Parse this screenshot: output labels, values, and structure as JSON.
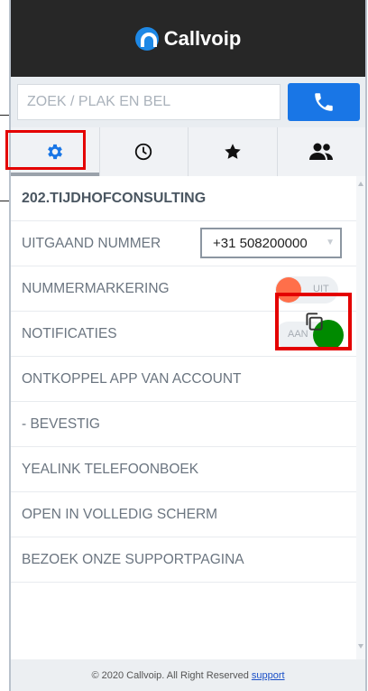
{
  "app": {
    "name": "Callvoip"
  },
  "search": {
    "placeholder": "ZOEK / PLAK EN BEL",
    "value": ""
  },
  "tabs": [
    {
      "name": "settings",
      "icon": "gear-icon"
    },
    {
      "name": "history",
      "icon": "clock-icon"
    },
    {
      "name": "favorites",
      "icon": "star-icon"
    },
    {
      "name": "contacts",
      "icon": "people-icon"
    }
  ],
  "settings": {
    "account": "202.TIJDHOFCONSULTING",
    "outgoing_label": "UITGAAND NUMMER",
    "outgoing_value": "+31 508200000",
    "marking_label": "NUMMERMARKERING",
    "marking_state": "UIT",
    "notifications_label": "NOTIFICATIES",
    "notifications_state": "AAN",
    "disconnect_label": "ONTKOPPEL APP VAN ACCOUNT",
    "confirm_label": "- BEVESTIG",
    "yealink_label": "YEALINK TELEFOONBOEK",
    "fullscreen_label": "OPEN IN VOLLEDIG SCHERM",
    "support_page_label": "BEZOEK ONZE SUPPORTPAGINA"
  },
  "footer": {
    "text": "© 2020 Callvoip. All Right Reserved",
    "link": "support"
  },
  "colors": {
    "accent": "#1976e6",
    "toggle_off": "#ff6f4a",
    "toggle_on": "#008a00",
    "highlight": "#e40000"
  }
}
